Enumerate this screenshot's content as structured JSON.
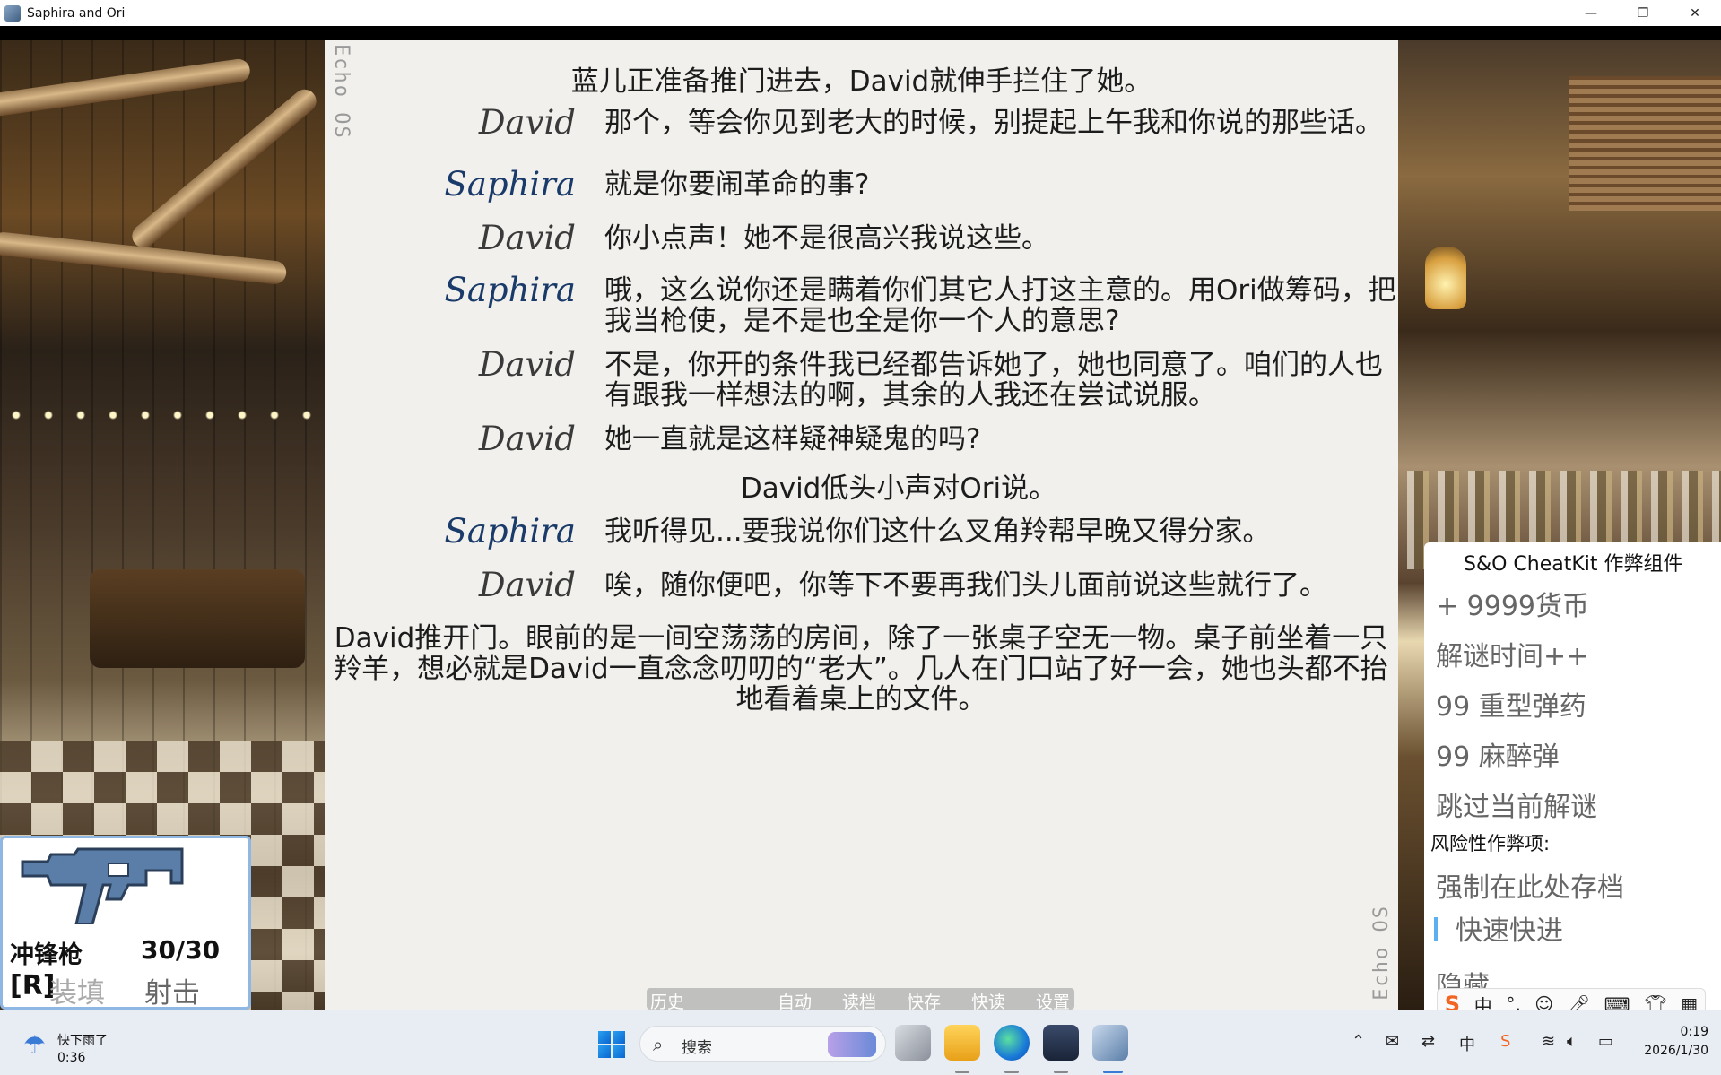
{
  "window": {
    "title": "Saphira and Ori",
    "minimize": "—",
    "restore": "❐",
    "close": "✕"
  },
  "panel": {
    "echo_left": "Echo OS",
    "echo_right": "Echo OS"
  },
  "story": {
    "narration_1": "蓝儿正准备推门进去，David就伸手拦住了她。",
    "lines": [
      {
        "speaker": "David",
        "text": "那个，等会你见到老大的时候，别提起上午我和你说的那些话。"
      },
      {
        "speaker": "Saphira",
        "text": "就是你要闹革命的事?"
      },
      {
        "speaker": "David",
        "text": "你小点声！她不是很高兴我说这些。"
      },
      {
        "speaker": "Saphira",
        "text": "哦，这么说你还是瞒着你们其它人打这主意的。用Ori做筹码，把我当枪使，是不是也全是你一个人的意思?"
      },
      {
        "speaker": "David",
        "text": "不是，你开的条件我已经都告诉她了，她也同意了。咱们的人也有跟我一样想法的啊，其余的人我还在尝试说服。"
      },
      {
        "speaker": "David",
        "text": "她一直就是这样疑神疑鬼的吗?"
      }
    ],
    "narration_2": "David低头小声对Ori说。",
    "lines_2": [
      {
        "speaker": "Saphira",
        "text": "我听得见...要我说你们这什么叉角羚帮早晚又得分家。"
      },
      {
        "speaker": "David",
        "text": "唉，随你便吧，你等下不要再我们头儿面前说这些就行了。"
      }
    ],
    "narration_3": "David推开门。眼前的是一间空荡荡的房间，除了一张桌子空无一物。桌子前坐着一只羚羊，想必就是David一直念念叨叨的“老大”。几人在门口站了好一会，她也头都不抬地看着桌上的文件。"
  },
  "quick_menu": {
    "history": "历史",
    "auto": "自动",
    "load": "读档",
    "quicksave": "快存",
    "quickload": "快读",
    "settings": "设置"
  },
  "weapon": {
    "name": "冲锋枪",
    "ammo": "30/30",
    "reload_key": "[R]",
    "reload": "装填",
    "fire": "射击"
  },
  "cheat": {
    "title": "S&O CheatKit 作弊组件",
    "items": [
      "+ 9999货币",
      "解谜时间++",
      "99 重型弹药",
      "99 麻醉弹",
      "跳过当前解谜"
    ],
    "risk_label": "风险性作弊项:",
    "risk_items": [
      "强制在此处存档",
      "快速快进",
      "隐藏"
    ]
  },
  "ime": {
    "lang": "中",
    "punct": "°,"
  },
  "taskbar": {
    "weather_text": "快下雨了",
    "weather_time": "0:36",
    "search_placeholder": "搜索",
    "tray_lang": "中",
    "clock_time": "0:19",
    "clock_date": "2026/1/30"
  },
  "colors": {
    "panel_bg": "#f1f0ec",
    "saphira": "#1a3a6a",
    "david": "#3a3a3a",
    "accent": "#5ab0f0"
  }
}
